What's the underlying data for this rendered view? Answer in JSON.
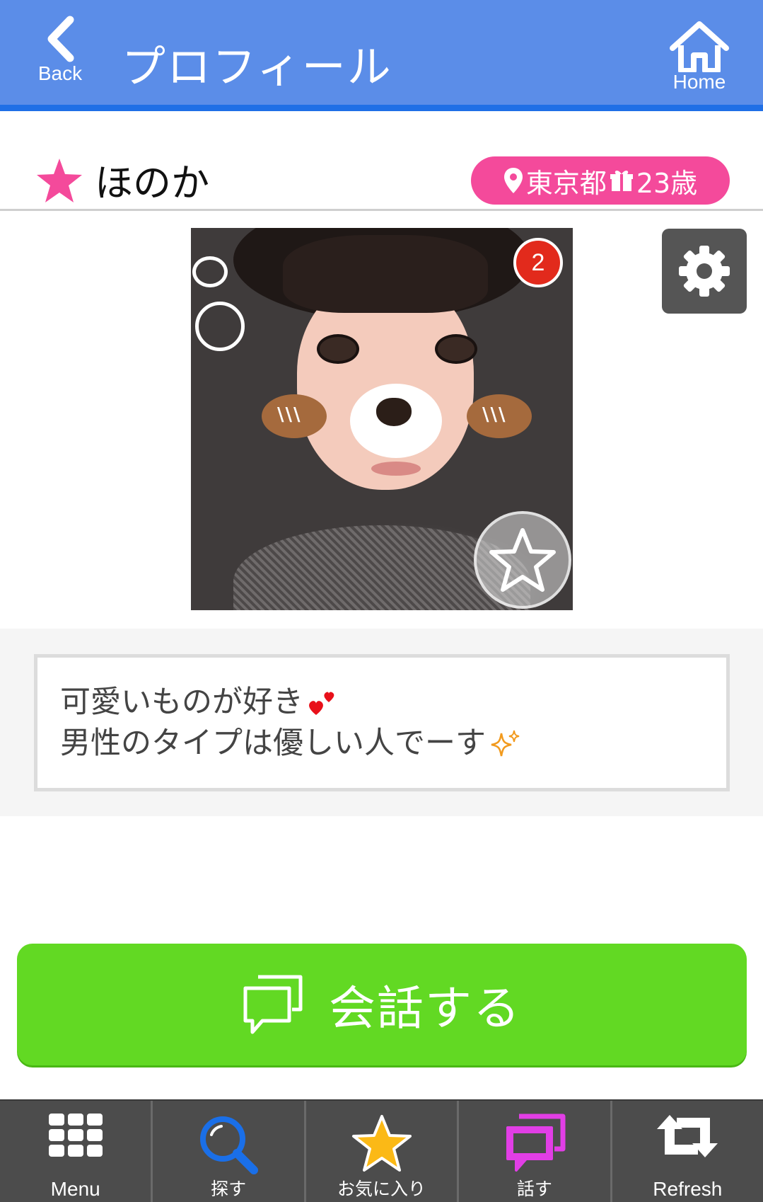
{
  "header": {
    "back_label": "Back",
    "title": "プロフィール",
    "home_label": "Home",
    "background_color": "#5b8de8"
  },
  "profile": {
    "name": "ほのか",
    "location": "東京都",
    "age": "23歳",
    "favorite_star_color": "#f44a9b",
    "badge_color": "#f44a9b",
    "photo_badge_count": "2"
  },
  "bio": {
    "line1": "可愛いものが好き",
    "line1_emoji": "hearts",
    "line2": "男性のタイプは優しい人でーす",
    "line2_emoji": "sparkles"
  },
  "actions": {
    "talk_label": "会話する",
    "talk_color": "#62d923"
  },
  "bottom_nav": {
    "items": [
      {
        "label": "Menu",
        "icon": "grid-icon"
      },
      {
        "label": "探す",
        "icon": "search-icon"
      },
      {
        "label": "お気に入り",
        "icon": "star-icon"
      },
      {
        "label": "話す",
        "icon": "chat-icon"
      },
      {
        "label": "Refresh",
        "icon": "refresh-icon"
      }
    ]
  }
}
